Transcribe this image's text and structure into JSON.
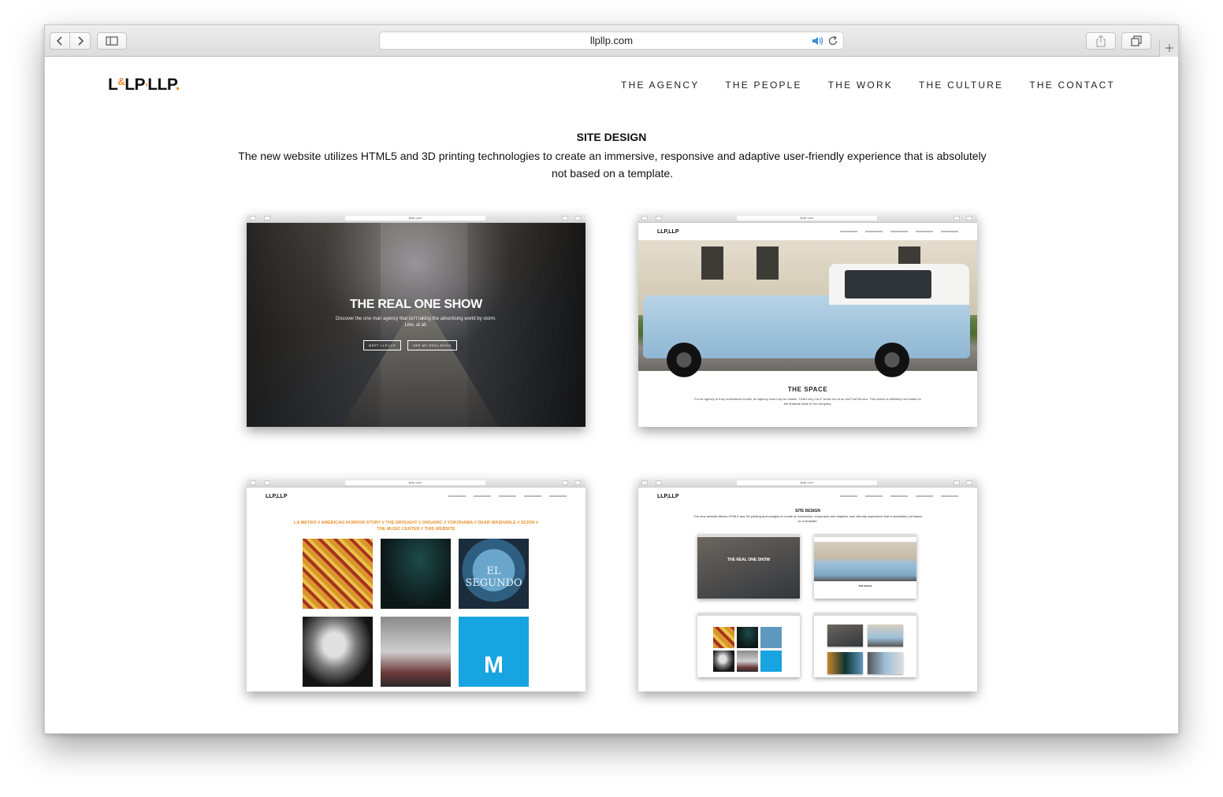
{
  "browser": {
    "url": "llpllp.com",
    "icons": {
      "back": "chevron-left-icon",
      "forward": "chevron-right-icon",
      "sidebar": "sidebar-icon",
      "audio": "speaker-icon",
      "reload": "reload-icon",
      "share": "share-icon",
      "tabs": "tabs-icon",
      "new_tab": "plus-icon"
    }
  },
  "site": {
    "logo": {
      "part1": "L",
      "amp": "&",
      "part2": "LP",
      "comma": ",",
      "part3": "LLP",
      "dot": "."
    },
    "accent_color": "#e88b2a",
    "nav": [
      "THE AGENCY",
      "THE PEOPLE",
      "THE WORK",
      "THE CULTURE",
      "THE CONTACT"
    ]
  },
  "section": {
    "title": "SITE DESIGN",
    "description": "The new website utilizes HTML5 and 3D printing technologies to create an immersive, responsive and adaptive user-friendly experience that is absolutely not based on a template."
  },
  "thumbnails": {
    "home": {
      "hero_title": "THE REAL ONE SHOW",
      "hero_sub": "Discover the one man agency that isn't taking the advertising world by storm. Like, at all.",
      "button1": "MEET LLP,LLP",
      "button2": "SEE MY REAL BOOK"
    },
    "culture": {
      "heading": "THE SPACE",
      "body": "For an agency to truly understand mobile, an agency must truly be mobile. That's why L&LP works out of an old Ford Bronco. This choice is definitely not related to the financial state of the company."
    },
    "work": {
      "links": "LA METRO // AMERICAN HORROR STORY // THE DROUGHT // ORGANIC // YOKOHAMA // DEAR WASHABLE // SCION // THE MUSIC CENTER // THIS WEBSITE",
      "tile_text": "EL SEGUNDO",
      "tile_letter": "M"
    },
    "site_design": {
      "title": "SITE DESIGN",
      "desc": "The new website utilizes HTML5 and 3D printing technologies to create an immersive, responsive and adaptive user-friendly experience that is absolutely not based on a template.",
      "nested_hero": "THE REAL ONE SHOW",
      "nested_space": "THE SPACE"
    },
    "mini_url": "llpllp.com",
    "mini_logo": "LLP,LLP"
  }
}
